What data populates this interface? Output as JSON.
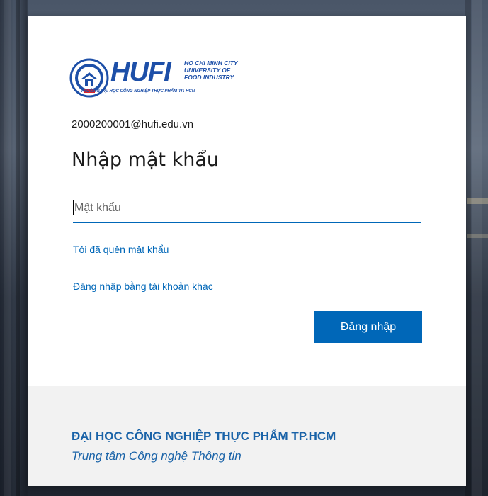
{
  "logo": {
    "brand": "HUFI",
    "side_line1": "HO CHI MINH CITY",
    "side_line2": "UNIVERSITY OF",
    "side_line3": "FOOD INDUSTRY",
    "subtitle": "TRƯỜNG ĐẠI HỌC CÔNG NGHIỆP THỰC PHẨM TP. HCM"
  },
  "account": {
    "email": "2000200001@hufi.edu.vn"
  },
  "form": {
    "title": "Nhập mật khẩu",
    "password_placeholder": "Mật khẩu",
    "password_value": ""
  },
  "links": {
    "forgot": "Tôi đã quên mật khẩu",
    "other_account": "Đăng nhập bằng tài khoản khác"
  },
  "actions": {
    "sign_in": "Đăng nhập"
  },
  "footer": {
    "organization": "ĐẠI HỌC CÔNG NGHIỆP THỰC PHẨM TP.HCM",
    "department": "Trung tâm Công nghệ Thông tin"
  },
  "colors": {
    "accent": "#0067b8",
    "footer_text": "#1a63a8",
    "footer_bg": "#f2f2f2"
  }
}
